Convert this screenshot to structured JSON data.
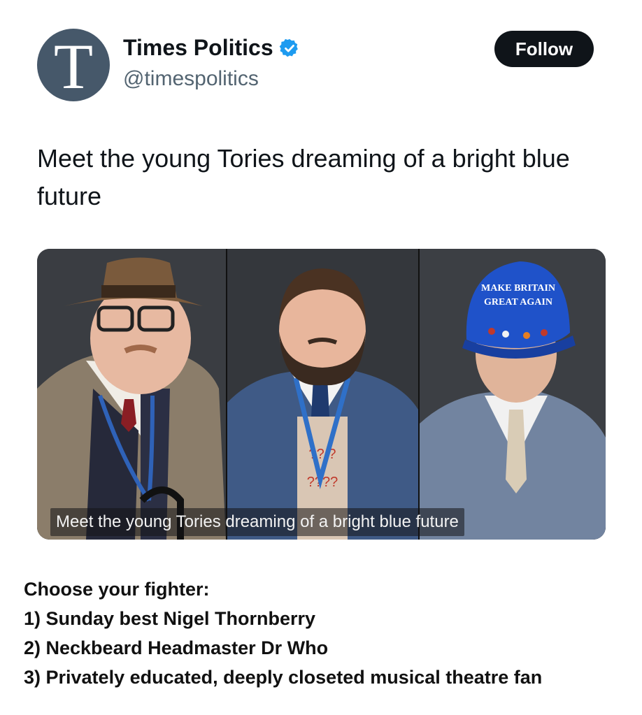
{
  "account": {
    "avatar_letter": "T",
    "display_name": "Times Politics",
    "handle": "@timespolitics",
    "verified_icon": "verified-badge-icon",
    "accent_color": "#1d9bf0"
  },
  "follow_button": {
    "label": "Follow"
  },
  "tweet": {
    "text": "Meet the young Tories dreaming of a bright blue future"
  },
  "media": {
    "caption": "Meet the young Tories dreaming of a bright blue future",
    "hat_text_line1": "MAKE BRITAIN",
    "hat_text_line2": "GREAT AGAIN",
    "lanyard_pattern_1": "?? ?",
    "lanyard_pattern_2": "????"
  },
  "comment": {
    "heading": "Choose your fighter:",
    "items": [
      "1) Sunday best Nigel Thornberry",
      "2) Neckbeard Headmaster Dr Who",
      "3) Privately educated, deeply closeted musical theatre fan"
    ]
  }
}
